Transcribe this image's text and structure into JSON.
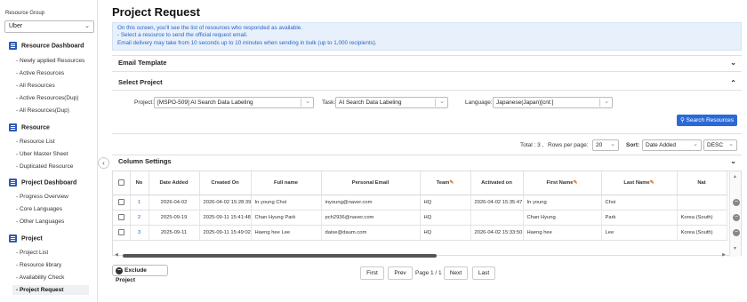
{
  "sidebar": {
    "group_label": "Resource Group",
    "group_value": "Uber",
    "sections": [
      {
        "title": "Resource Dashboard",
        "icon": "menu-icon",
        "items": [
          "- Newly applied Resources",
          "- Active Resources",
          "- All Resources",
          "- Active Resources(Dup)",
          "- All Resources(Dup)"
        ]
      },
      {
        "title": "Resource",
        "icon": "menu-icon",
        "items": [
          "- Resource List",
          "- Uber Master Sheet",
          "- Duplicated Resource"
        ]
      },
      {
        "title": "Project Dashboard",
        "icon": "menu-icon",
        "items": [
          "- Progress Overview",
          "- Core Languages",
          "- Other Languages"
        ]
      },
      {
        "title": "Project",
        "icon": "menu-icon",
        "items": [
          "- Project List",
          "- Resource library",
          "- Availability Check",
          "- Project Request"
        ]
      }
    ],
    "active_item": "- Project Request"
  },
  "page": {
    "title": "Project Request",
    "info_lines": [
      "On this screen, you'll see the list of resources who responded as available.",
      "- Select a resource to send the official request email.",
      "Email delivery may take from 10 seconds up to 10 minutes when sending in bulk (up to 1,000 recipients)."
    ]
  },
  "email_template": {
    "title": "Email Template"
  },
  "select_project": {
    "title": "Select Project",
    "project_label": "Project:",
    "project_value": "[MSPO-509] AI Search Data Labeling",
    "task_label": "Task:",
    "task_value": "AI Search Data Labeling",
    "language_label": "Language:",
    "language_value": "Japanese(Japan)[cnt:]",
    "search_button": "Search Resources"
  },
  "list_controls": {
    "total_text": "Total : 3 ,",
    "rows_label": "Rows per page:",
    "rows_value": "20",
    "sort_label": "Sort:",
    "sort_field": "Date Added",
    "sort_dir": "DESC"
  },
  "column_settings": {
    "title": "Column Settings"
  },
  "table": {
    "headers": [
      "No",
      "Date Added",
      "Created On",
      "Full name",
      "Personal Email",
      "Team",
      "Activated on",
      "First Name",
      "Last Name",
      "Nat"
    ],
    "rows": [
      {
        "no": "1",
        "date_added": "2026-04-02",
        "created_on": "2026-04-02 15:28:39",
        "full_name": "In young Choi",
        "email": "inyoung@naver.com",
        "team": "HQ",
        "activated_on": "2026-04-02 15:35:47",
        "first_name": "In young",
        "last_name": "Choi",
        "nat": ""
      },
      {
        "no": "2",
        "date_added": "2025-09-19",
        "created_on": "2025-09-11 15:41:48",
        "full_name": "Chan Hyung Park",
        "email": "pch2936@naver.com",
        "team": "HQ",
        "activated_on": "",
        "first_name": "Chan Hyung",
        "last_name": "Park",
        "nat": "Korea (South)"
      },
      {
        "no": "3",
        "date_added": "2025-09-11",
        "created_on": "2025-09-11 15:49:02",
        "full_name": "Haeng hee Lee",
        "email": "daise@daum.com",
        "team": "HQ",
        "activated_on": "2026-04-02 15:33:50",
        "first_name": "Haeng hee",
        "last_name": "Lee",
        "nat": "Korea (South)"
      }
    ]
  },
  "actions": {
    "exclude_button": "Exclude Project"
  },
  "pagination": {
    "first": "First",
    "prev": "Prev",
    "page_text": "Page 1 / 1",
    "next": "Next",
    "last": "Last"
  },
  "colors": {
    "accent": "#2b6ad6",
    "info_bg": "#e8f1fb",
    "info_text": "#2b62c8",
    "nav_icon": "#2f59b8",
    "edit_pencil": "#e07a2b"
  }
}
